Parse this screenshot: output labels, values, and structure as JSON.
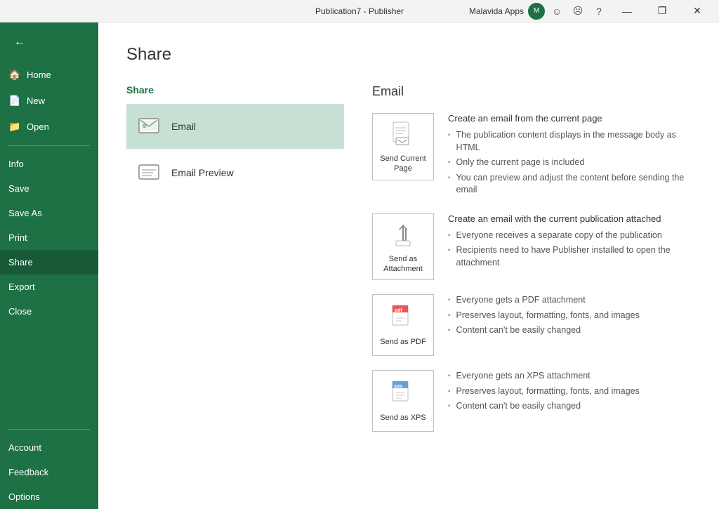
{
  "titlebar": {
    "title": "Publication7 - Publisher",
    "malavida": "Malavida Apps",
    "buttons": {
      "minimize": "—",
      "restore": "❐",
      "close": "✕",
      "help": "?",
      "happy": "☺",
      "sad": "☹"
    }
  },
  "sidebar": {
    "back_label": "←",
    "items": [
      {
        "id": "home",
        "label": "Home",
        "icon": "🏠"
      },
      {
        "id": "new",
        "label": "New",
        "icon": "📄"
      },
      {
        "id": "open",
        "label": "Open",
        "icon": "📁"
      }
    ],
    "divider1": true,
    "middle_items": [
      {
        "id": "info",
        "label": "Info",
        "icon": ""
      },
      {
        "id": "save",
        "label": "Save",
        "icon": ""
      },
      {
        "id": "save-as",
        "label": "Save As",
        "icon": ""
      },
      {
        "id": "print",
        "label": "Print",
        "icon": ""
      },
      {
        "id": "share",
        "label": "Share",
        "icon": "",
        "active": true
      },
      {
        "id": "export",
        "label": "Export",
        "icon": ""
      },
      {
        "id": "close",
        "label": "Close",
        "icon": ""
      }
    ],
    "divider2": true,
    "bottom_items": [
      {
        "id": "account",
        "label": "Account",
        "icon": ""
      },
      {
        "id": "feedback",
        "label": "Feedback",
        "icon": ""
      },
      {
        "id": "options",
        "label": "Options",
        "icon": ""
      }
    ]
  },
  "page": {
    "title": "Share"
  },
  "share_panel": {
    "title": "Share",
    "options": [
      {
        "id": "email",
        "label": "Email",
        "icon": "email",
        "selected": true
      },
      {
        "id": "email-preview",
        "label": "Email Preview",
        "icon": "email-preview",
        "selected": false
      }
    ]
  },
  "email_panel": {
    "title": "Email",
    "cards": [
      {
        "id": "send-current-page",
        "label": "Send Current\nPage",
        "title": "Create an email from the current page",
        "bullets": [
          "The publication content displays in the message body as HTML",
          "Only the current page is included",
          "You can preview and adjust the content before sending the email"
        ]
      },
      {
        "id": "send-as-attachment",
        "label": "Send as\nAttachment",
        "title": "Create an email with the current publication attached",
        "bullets": [
          "Everyone receives a separate copy of the publication",
          "Recipients need to have Publisher installed to open the attachment"
        ]
      },
      {
        "id": "send-as-pdf",
        "label": "Send as PDF",
        "title": "",
        "bullets": [
          "Everyone gets a PDF attachment",
          "Preserves layout, formatting, fonts, and images",
          "Content can't be easily changed"
        ]
      },
      {
        "id": "send-as-xps",
        "label": "Send as XPS",
        "title": "",
        "bullets": [
          "Everyone gets an XPS attachment",
          "Preserves layout, formatting, fonts, and images",
          "Content can't be easily changed"
        ]
      }
    ]
  }
}
